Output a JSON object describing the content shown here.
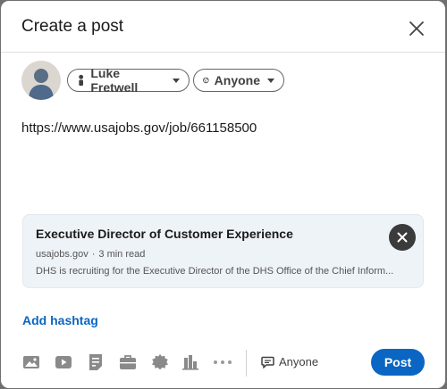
{
  "dialog": {
    "title": "Create a post"
  },
  "author": {
    "name": "Luke Fretwell"
  },
  "audience": {
    "label": "Anyone"
  },
  "post": {
    "text": "https://www.usajobs.gov/job/661158500"
  },
  "link_preview": {
    "title": "Executive Director of Customer Experience",
    "domain": "usajobs.gov",
    "separator": "·",
    "read_time": "3 min read",
    "description": "DHS is recruiting for the Executive Director of the DHS Office of the Chief Inform..."
  },
  "hashtag": {
    "label": "Add hashtag"
  },
  "toolbar": {
    "tools": [
      "photo-icon",
      "video-icon",
      "document-icon",
      "job-icon",
      "celebrate-icon",
      "poll-icon",
      "more-icon"
    ],
    "comment_control_label": "Anyone",
    "post_label": "Post"
  },
  "colors": {
    "accent": "#0a66c2",
    "preview_bg": "#eef3f8",
    "icon_gray": "#666666"
  }
}
